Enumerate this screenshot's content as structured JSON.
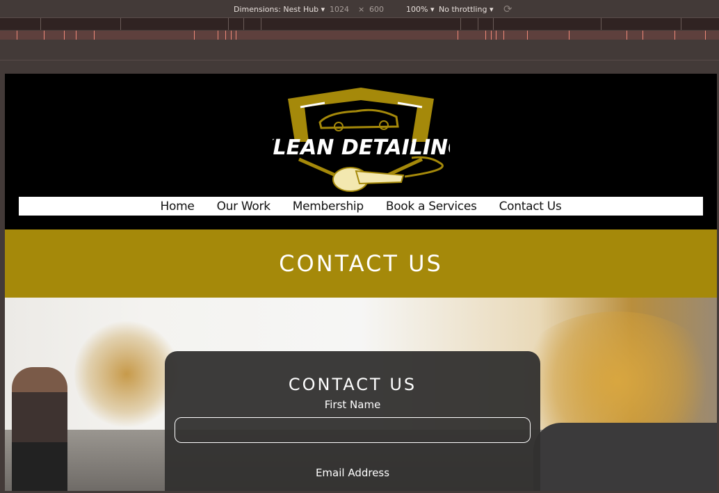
{
  "devtools": {
    "dimensions_label": "Dimensions: Nest Hub",
    "width": "1024",
    "times": "×",
    "height": "600",
    "zoom": "100%",
    "throttling": "No throttling",
    "rotate_icon": "rotate-icon"
  },
  "site": {
    "logo_text": "KLEAN DETAILING",
    "nav": [
      "Home",
      "Our Work",
      "Membership",
      "Book a Services",
      "Contact Us"
    ],
    "banner_title": "CONTACT US",
    "form": {
      "title": "CONTACT US",
      "first_name_label": "First Name",
      "first_name_value": "",
      "email_label": "Email Address"
    },
    "colors": {
      "gold": "#a5890a",
      "header_bg": "#000000",
      "card_bg": "#32302f"
    }
  }
}
